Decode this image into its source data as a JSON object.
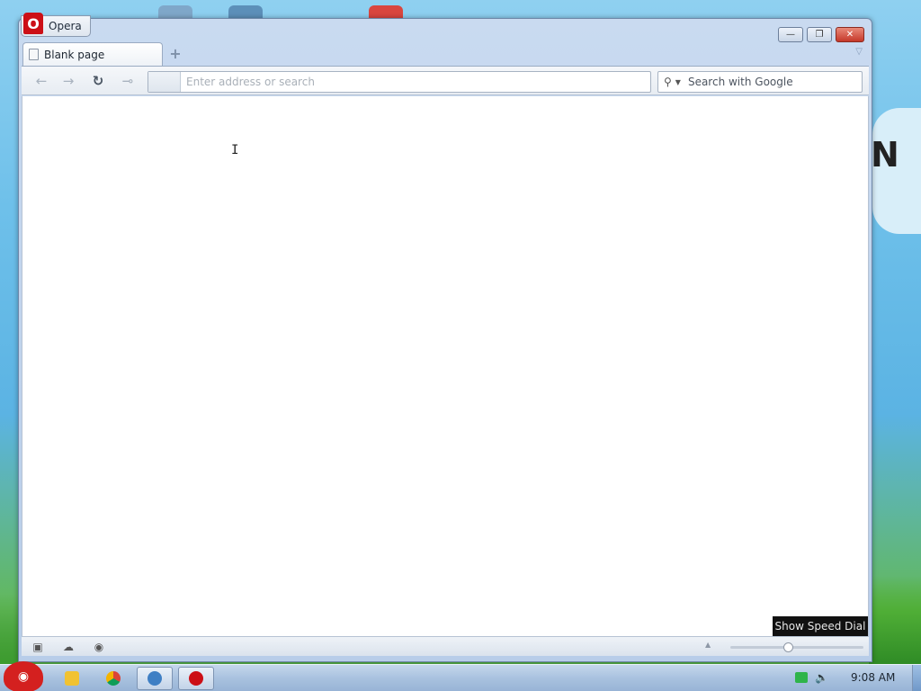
{
  "window": {
    "app_label": "Opera",
    "controls": {
      "minimize": "—",
      "maximize": "❐",
      "close": "✕"
    }
  },
  "tabs": [
    {
      "label": "Blank page",
      "icon": "page-icon",
      "active": true
    }
  ],
  "new_tab": "+",
  "toolbar": {
    "back_icon": "←",
    "forward_icon": "→",
    "reload_icon": "↻",
    "key_icon": "⊸",
    "address": {
      "value": "",
      "placeholder": "Enter address or search"
    },
    "search": {
      "value": "",
      "placeholder": "Search with Google",
      "engine": "Google"
    }
  },
  "tooltip": "Show Speed Dial",
  "statusbar": {
    "panel_icon": "▣",
    "cloud_icon": "☁",
    "turbo_icon": "◉",
    "zoom_level": 0.43
  },
  "taskbar": {
    "start_label": "◉",
    "clock": "9:08 AM"
  },
  "colors": {
    "accent_red": "#cc0f16",
    "window_frame": "#b8cde9",
    "taskbar": "#a9c2df"
  }
}
